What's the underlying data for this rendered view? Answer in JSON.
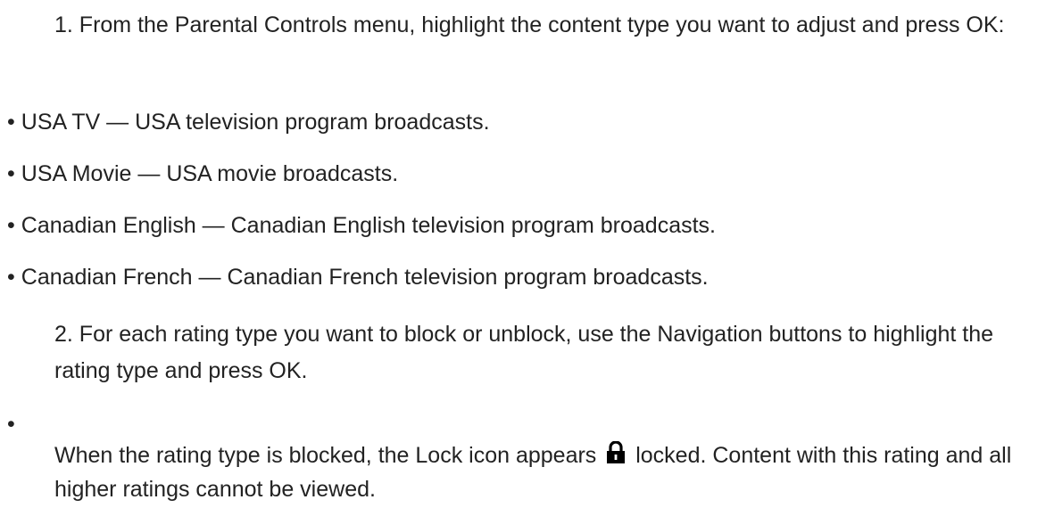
{
  "steps": {
    "step1": "1. From the Parental Controls menu, highlight the content type you want to adjust and press OK:",
    "step2": "2. For each rating type you want to block or unblock, use the Navigation buttons to highlight the rating type and press OK."
  },
  "bullet_glyph": "•",
  "content_types": [
    "USA TV — USA television program broadcasts.",
    "USA Movie — USA movie broadcasts.",
    "Canadian English — Canadian English television program broadcasts.",
    "Canadian French — Canadian French television program broadcasts."
  ],
  "lock_note": {
    "before_icon": "When the rating type is blocked, the Lock icon appears",
    "icon": "lock-icon",
    "after_icon": "locked. Content with this rating and all higher ratings cannot be viewed."
  }
}
